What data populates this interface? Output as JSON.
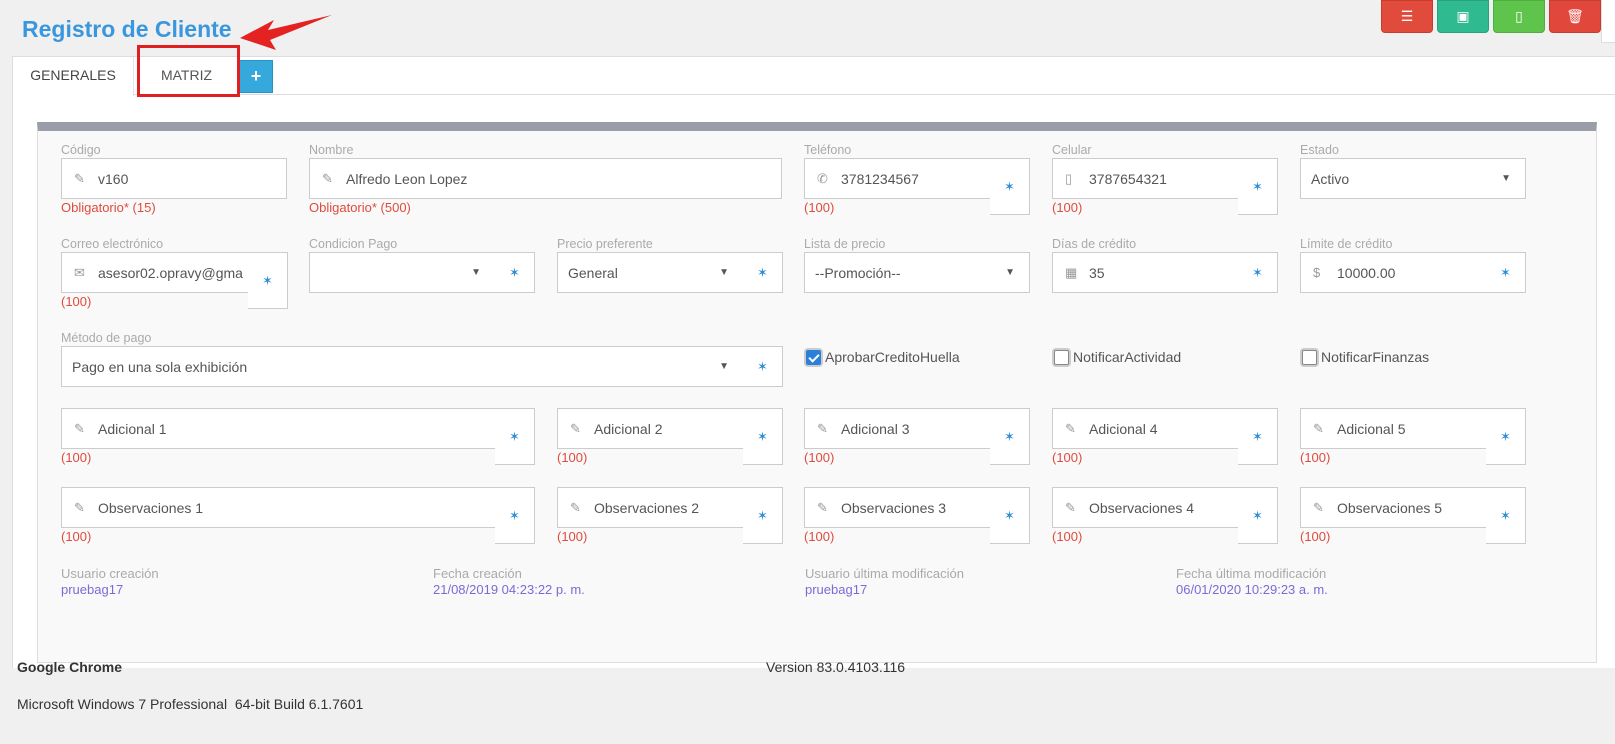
{
  "header": {
    "title": "Registro de Cliente"
  },
  "toolbar": [
    {
      "name": "list-icon",
      "glyph": "☰"
    },
    {
      "name": "save-icon",
      "glyph": "▣"
    },
    {
      "name": "new-document-icon",
      "glyph": "▯"
    },
    {
      "name": "trash-icon",
      "glyph": "🗑"
    }
  ],
  "tabs": {
    "generales": "GENERALES",
    "matriz": "MATRIZ",
    "add": "+"
  },
  "form": {
    "codigo": {
      "label": "Código",
      "value": "v160",
      "hint": "Obligatorio* (15)"
    },
    "nombre": {
      "label": "Nombre",
      "value": "Alfredo Leon Lopez",
      "hint": "Obligatorio* (500)"
    },
    "telefono": {
      "label": "Teléfono",
      "value": "3781234567",
      "hint": "(100)"
    },
    "celular": {
      "label": "Celular",
      "value": "3787654321",
      "hint": "(100)"
    },
    "estado": {
      "label": "Estado",
      "value": "Activo"
    },
    "correo": {
      "label": "Correo electrónico",
      "value": "asesor02.opravy@gma",
      "hint": "(100)"
    },
    "condicion_pago": {
      "label": "Condicion Pago",
      "value": ""
    },
    "precio_preferente": {
      "label": "Precio preferente",
      "value": "General"
    },
    "lista_precio": {
      "label": "Lista de precio",
      "value": "--Promoción--"
    },
    "dias_credito": {
      "label": "Días de crédito",
      "value": "35"
    },
    "limite_credito": {
      "label": "Límite de crédito",
      "value": "10000.00",
      "prefix": "$"
    },
    "metodo_pago": {
      "label": "Método de pago",
      "value": "Pago en una sola exhibición"
    },
    "checks": {
      "aprobar": {
        "label": "AprobarCreditoHuella",
        "checked": true
      },
      "notificar_actividad": {
        "label": "NotificarActividad",
        "checked": false
      },
      "notificar_finanzas": {
        "label": "NotificarFinanzas",
        "checked": false
      }
    },
    "adicionales": [
      {
        "placeholder": "Adicional 1",
        "hint": "(100)"
      },
      {
        "placeholder": "Adicional 2",
        "hint": "(100)"
      },
      {
        "placeholder": "Adicional 3",
        "hint": "(100)"
      },
      {
        "placeholder": "Adicional 4",
        "hint": "(100)"
      },
      {
        "placeholder": "Adicional 5",
        "hint": "(100)"
      }
    ],
    "observaciones": [
      {
        "placeholder": "Observaciones 1",
        "hint": "(100)"
      },
      {
        "placeholder": "Observaciones 2",
        "hint": "(100)"
      },
      {
        "placeholder": "Observaciones 3",
        "hint": "(100)"
      },
      {
        "placeholder": "Observaciones 4",
        "hint": "(100)"
      },
      {
        "placeholder": "Observaciones 5",
        "hint": "(100)"
      }
    ]
  },
  "audit": {
    "usuario_creacion": {
      "label": "Usuario creación",
      "value": "pruebag17"
    },
    "fecha_creacion": {
      "label": "Fecha creación",
      "value": "21/08/2019 04:23:22 p. m."
    },
    "usuario_modificacion": {
      "label": "Usuario última modificación",
      "value": "pruebag17"
    },
    "fecha_modificacion": {
      "label": "Fecha última modificación",
      "value": "06/01/2020 10:29:23 a. m."
    }
  },
  "footer": {
    "browser": "Google Chrome",
    "version": "Version 83.0.4103.116",
    "os": "Microsoft Windows 7 Professional  64-bit Build 6.1.7601"
  },
  "colors": {
    "accent": "#3a97dd",
    "danger": "#e04b3b",
    "link": "#7b6bd4"
  }
}
